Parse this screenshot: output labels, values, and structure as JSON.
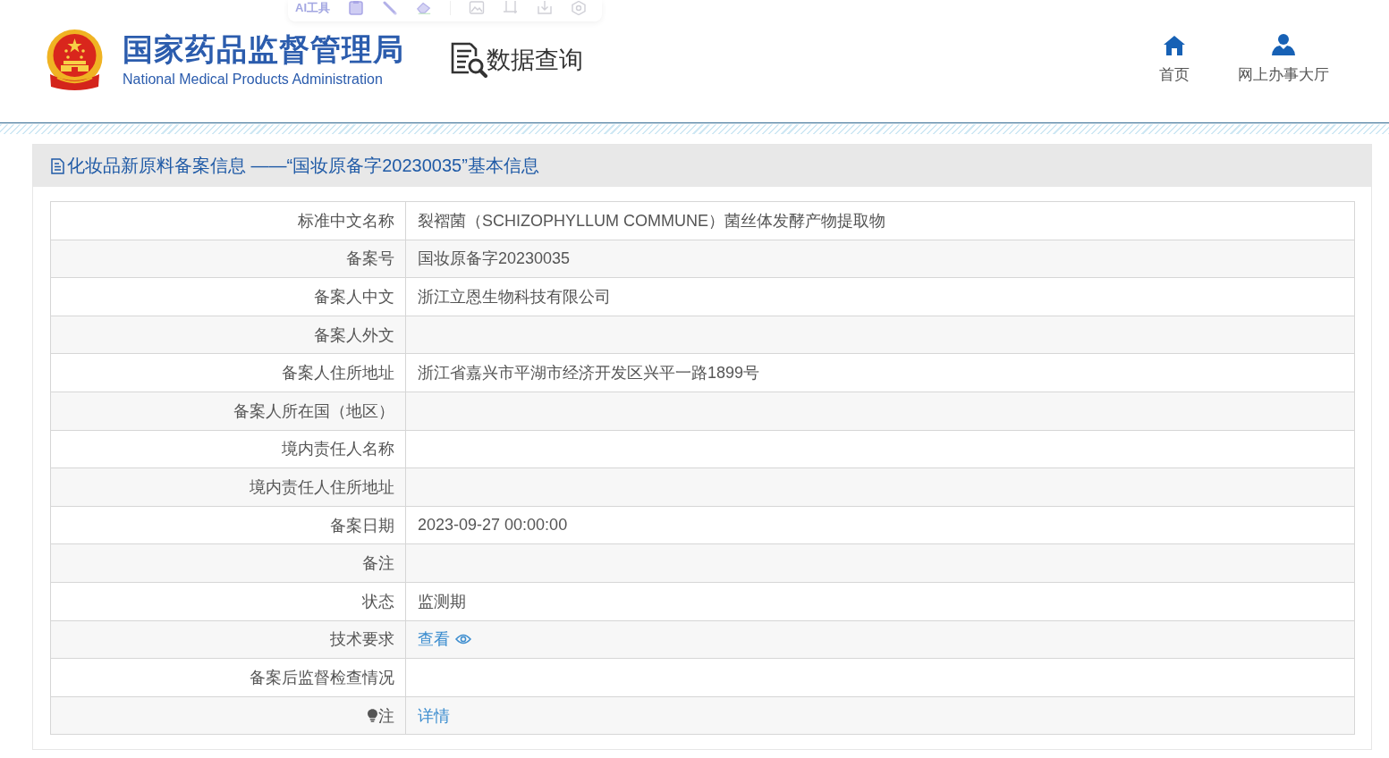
{
  "toolbar": {
    "label": "AI工具"
  },
  "header": {
    "title": "国家药品监督管理局",
    "subtitle": "National Medical Products Administration",
    "section": "数据查询",
    "nav": [
      {
        "kind": "home",
        "label": "首页"
      },
      {
        "kind": "user",
        "label": "网上办事大厅"
      }
    ]
  },
  "panel": {
    "title": "化妆品新原料备案信息 ——“国妆原备字20230035”基本信息"
  },
  "table": {
    "rows": [
      {
        "kind": "text",
        "label": "标准中文名称",
        "value": "裂褶菌（SCHIZOPHYLLUM COMMUNE）菌丝体发酵产物提取物"
      },
      {
        "kind": "text",
        "label": "备案号",
        "value": "国妆原备字20230035"
      },
      {
        "kind": "text",
        "label": "备案人中文",
        "value": "浙江立恩生物科技有限公司"
      },
      {
        "kind": "text",
        "label": "备案人外文"
      },
      {
        "kind": "text",
        "label": "备案人住所地址",
        "value": "浙江省嘉兴市平湖市经济开发区兴平一路1899号"
      },
      {
        "kind": "text",
        "label": "备案人所在国（地区）"
      },
      {
        "kind": "text",
        "label": "境内责任人名称"
      },
      {
        "kind": "text",
        "label": "境内责任人住所地址"
      },
      {
        "kind": "text",
        "label": "备案日期",
        "value": "2023-09-27 00:00:00"
      },
      {
        "kind": "text",
        "label": "备注"
      },
      {
        "kind": "text",
        "label": "状态",
        "value": "监测期"
      },
      {
        "kind": "view-link",
        "label": "技术要求",
        "value": "查看"
      },
      {
        "kind": "text",
        "label": "备案后监督检查情况"
      },
      {
        "kind": "note-link",
        "label": "注",
        "value": "详情"
      }
    ]
  }
}
